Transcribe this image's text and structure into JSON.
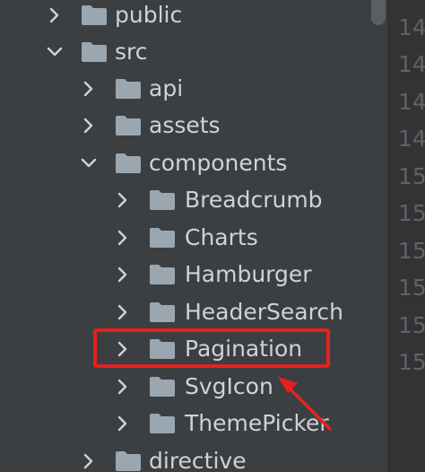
{
  "project_tree": {
    "items": [
      {
        "label": "public",
        "expanded": false,
        "depth": 0
      },
      {
        "label": "src",
        "expanded": true,
        "depth": 0
      },
      {
        "label": "api",
        "expanded": false,
        "depth": 1
      },
      {
        "label": "assets",
        "expanded": false,
        "depth": 1
      },
      {
        "label": "components",
        "expanded": true,
        "depth": 1
      },
      {
        "label": "Breadcrumb",
        "expanded": false,
        "depth": 2
      },
      {
        "label": "Charts",
        "expanded": false,
        "depth": 2
      },
      {
        "label": "Hamburger",
        "expanded": false,
        "depth": 2
      },
      {
        "label": "HeaderSearch",
        "expanded": false,
        "depth": 2
      },
      {
        "label": "Pagination",
        "expanded": false,
        "depth": 2
      },
      {
        "label": "SvgIcon",
        "expanded": false,
        "depth": 2
      },
      {
        "label": "ThemePicker",
        "expanded": false,
        "depth": 2
      },
      {
        "label": "directive",
        "expanded": false,
        "depth": 1
      }
    ]
  },
  "gutter": {
    "line_numbers": [
      "14",
      "14",
      "14",
      "14",
      "15",
      "15",
      "15",
      "15",
      "15",
      "15"
    ]
  },
  "annotation": {
    "highlighted_item": "Pagination",
    "color": "#e8201d"
  },
  "colors": {
    "tree_background": "#3c3f41",
    "gutter_background": "#313335",
    "folder": "#9aa7b0",
    "text": "#cfd3d6",
    "line_number": "#606366"
  }
}
